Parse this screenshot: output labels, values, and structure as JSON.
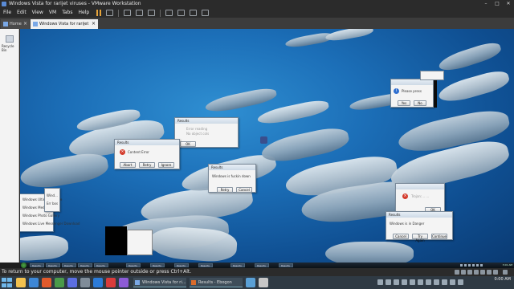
{
  "window": {
    "title": "Windows Vista for rarijet viruses - VMware Workstation"
  },
  "menu": [
    "File",
    "Edit",
    "View",
    "VM",
    "Tabs",
    "Help"
  ],
  "tabs": [
    {
      "label": "Home"
    },
    {
      "label": "Windows Vista for rarijet vir..."
    }
  ],
  "library": {
    "label": "Recycle Bin"
  },
  "dialogs": {
    "d1": {
      "title": "Results",
      "line1": "Error reading",
      "line2": "No object cols",
      "button": "OK"
    },
    "d2": {
      "title": "Results",
      "message": "Content Error",
      "buttons": [
        "Abort",
        "Retry",
        "Ignore"
      ]
    },
    "d3": {
      "title": "Results",
      "message": "Windows is fuckin down",
      "buttons": [
        "Retry",
        "Cancel"
      ]
    },
    "d4": {
      "title": "",
      "message": "Please press",
      "buttons": [
        "Yes",
        "No"
      ]
    },
    "d5": {
      "title": "",
      "message": "Trojan:... ...",
      "button": "OK"
    },
    "d6": {
      "title": "Results",
      "message": "Windows is in Danger",
      "buttons": [
        "Cancel",
        "Try Again",
        "Continue"
      ]
    },
    "d7": {
      "title": "Results",
      "items": [
        "Windows Ultimate Home",
        "Windows Media Player",
        "Windows Photo Gallery",
        "Windows Live Messenger Download"
      ],
      "side": [
        "Wind...",
        "Err bos"
      ]
    }
  },
  "guest_taskbar": {
    "tasks": [
      "Results",
      "Results",
      "Results",
      "Results",
      "Results",
      "Results",
      "Results",
      "Results",
      "Results",
      "Results",
      "Results",
      "Results"
    ],
    "clock": "3:01 AM"
  },
  "status": {
    "text": "To return to your computer, move the mouse pointer outside or press Ctrl+Alt."
  },
  "host_taskbar": {
    "windows": [
      "Windows Vista for ri...",
      "Results - Ebogon"
    ],
    "clock": "0:00 AM",
    "date": ""
  },
  "colors": {
    "accent": "#2f6fd0",
    "error": "#d33b2c",
    "chrome": "#2b2b2b"
  },
  "icons": [
    "vmware-icon",
    "pause-icon",
    "snapshot-icon",
    "fullscreen-icon",
    "unity-icon",
    "recycle-bin-icon",
    "error-icon",
    "info-icon",
    "start-orb-icon",
    "windows-start-icon"
  ]
}
